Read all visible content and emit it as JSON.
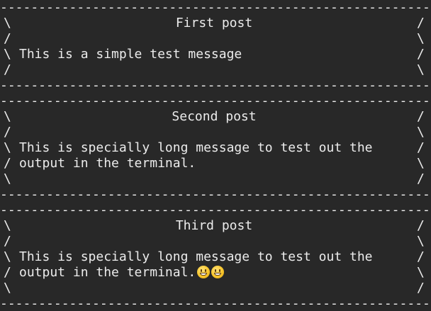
{
  "terminal": {
    "separator": "------------------------------------------------------------",
    "posts": [
      {
        "title": "First post",
        "frame": [
          "\\",
          "/",
          "\\",
          "/"
        ],
        "frame_right": [
          "/",
          "\\",
          "/",
          "\\"
        ],
        "body_lines": [
          "This is a simple test message"
        ]
      },
      {
        "title": "Second post",
        "frame": [
          "\\",
          "/",
          "\\",
          "/",
          "\\"
        ],
        "frame_right": [
          "/",
          "\\",
          "/",
          "\\",
          "/"
        ],
        "body_lines": [
          "This is specially long message to test out the",
          "output in the terminal."
        ]
      },
      {
        "title": "Third post",
        "frame": [
          "\\",
          "/",
          "\\",
          "/",
          "\\"
        ],
        "frame_right": [
          "/",
          "\\",
          "/",
          "\\",
          "/"
        ],
        "body_lines": [
          "This is specially long message to test out the",
          "output in the terminal."
        ],
        "emojis": [
          "grinning-face",
          "smiley-face"
        ]
      }
    ]
  }
}
